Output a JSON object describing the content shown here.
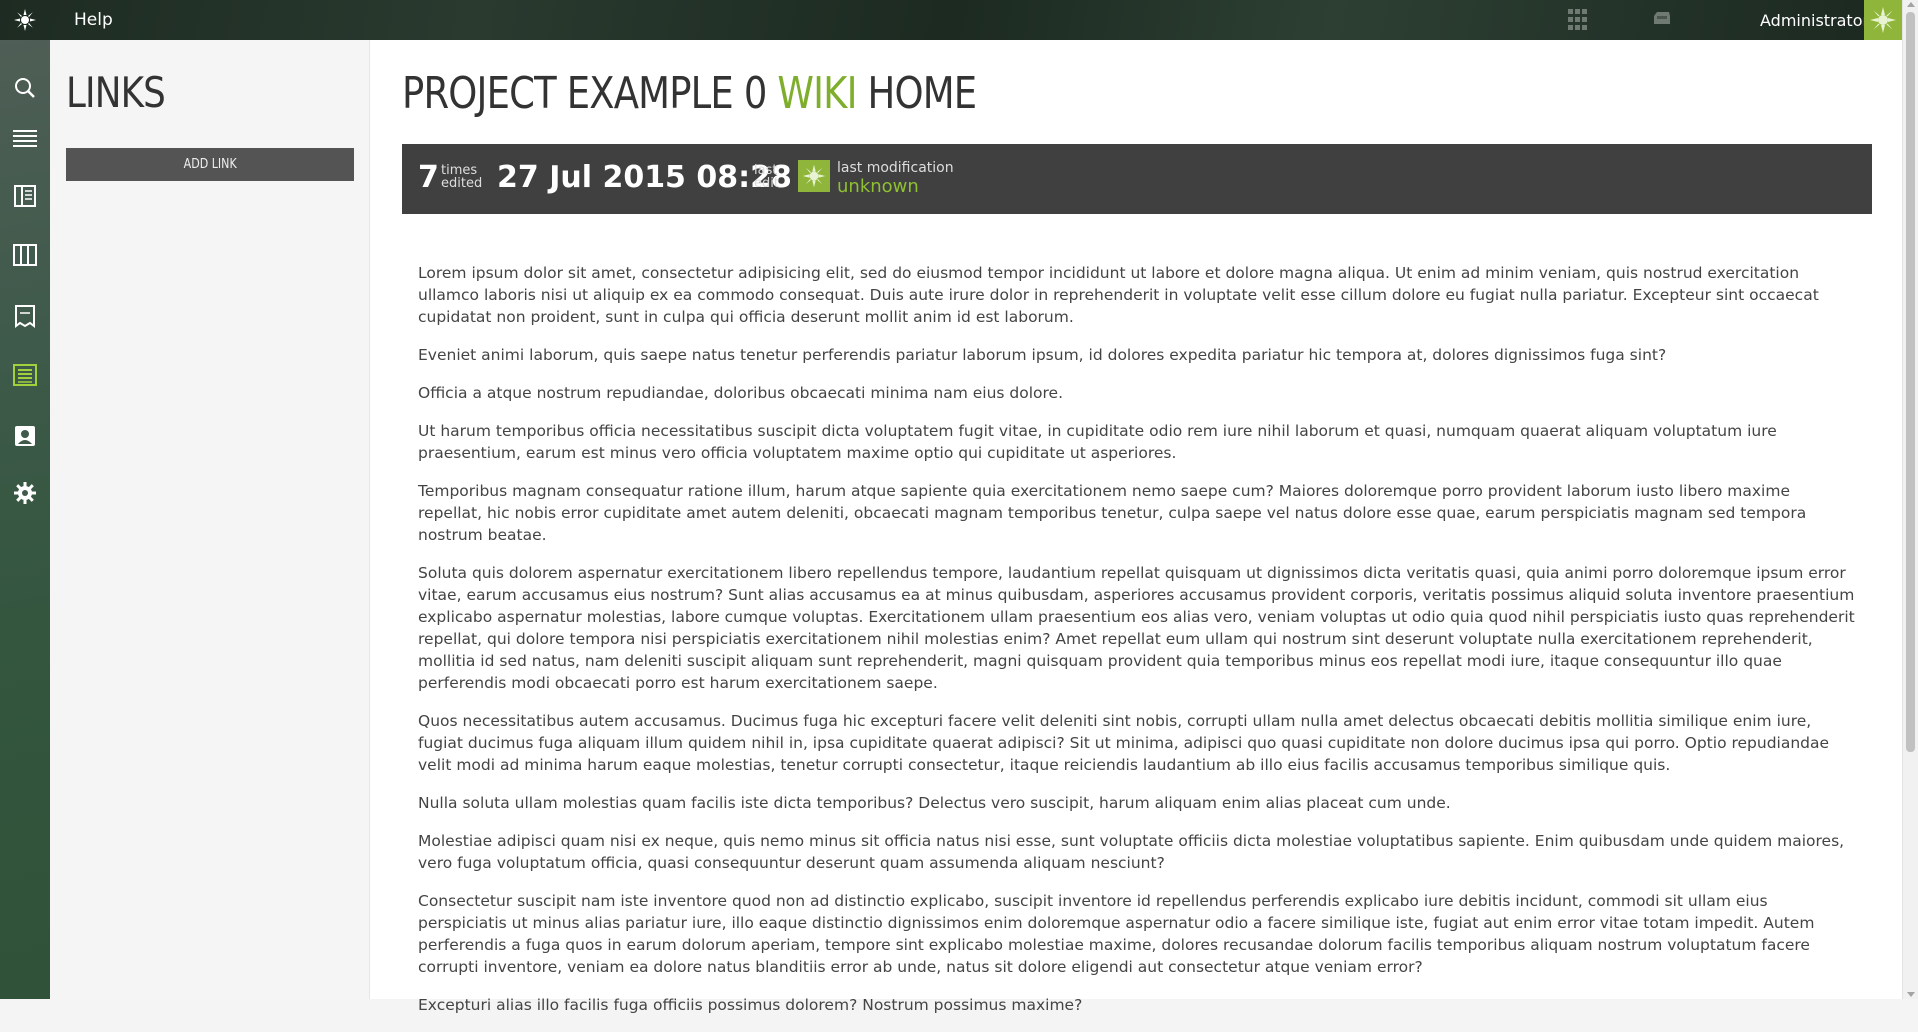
{
  "topbar": {
    "help_label": "Help",
    "user_name": "Administrator"
  },
  "links_panel": {
    "title": "LINKS",
    "add_link_label": "ADD LINK"
  },
  "page": {
    "title_part1": "PROJECT EXAMPLE 0 ",
    "title_accent": "WIKI",
    "title_part2": " HOME"
  },
  "stats": {
    "times_edited_value": "7",
    "times_edited_label_line1": "times",
    "times_edited_label_line2": "edited",
    "last_edit_value": "27 Jul 2015 08:28",
    "last_edit_label_line1": "last",
    "last_edit_label_line2": "edit",
    "last_modification_label": "last modification",
    "last_modification_user": "unknown"
  },
  "content": {
    "paragraphs": [
      "Lorem ipsum dolor sit amet, consectetur adipisicing elit, sed do eiusmod tempor incididunt ut labore et dolore magna aliqua. Ut enim ad minim veniam, quis nostrud exercitation ullamco laboris nisi ut aliquip ex ea commodo consequat. Duis aute irure dolor in reprehenderit in voluptate velit esse cillum dolore eu fugiat nulla pariatur. Excepteur sint occaecat cupidatat non proident, sunt in culpa qui officia deserunt mollit anim id est laborum.",
      "Eveniet animi laborum, quis saepe natus tenetur perferendis pariatur laborum ipsum, id dolores expedita pariatur hic tempora at, dolores dignissimos fuga sint?",
      "Officia a atque nostrum repudiandae, doloribus obcaecati minima nam eius dolore.",
      "Ut harum temporibus officia necessitatibus suscipit dicta voluptatem fugit vitae, in cupiditate odio rem iure nihil laborum et quasi, numquam quaerat aliquam voluptatum iure praesentium, earum est minus vero officia voluptatem maxime optio qui cupiditate ut asperiores.",
      "Temporibus magnam consequatur ratione illum, harum atque sapiente quia exercitationem nemo saepe cum? Maiores doloremque porro provident laborum iusto libero maxime repellat, hic nobis error cupiditate amet autem deleniti, obcaecati magnam temporibus tenetur, culpa saepe vel natus dolore esse quae, earum perspiciatis magnam sed tempora nostrum beatae.",
      "Soluta quis dolorem aspernatur exercitationem libero repellendus tempore, laudantium repellat quisquam ut dignissimos dicta veritatis quasi, quia animi porro doloremque ipsum error vitae, earum accusamus eius nostrum? Sunt alias accusamus ea at minus quibusdam, asperiores accusamus provident corporis, veritatis possimus aliquid soluta inventore praesentium explicabo aspernatur molestias, labore cumque voluptas. Exercitationem ullam praesentium eos alias vero, veniam voluptas ut odio quia quod nihil perspiciatis iusto quas reprehenderit repellat, qui dolore tempora nisi perspiciatis exercitationem nihil molestias enim? Amet repellat eum ullam qui nostrum sint deserunt voluptate nulla exercitationem reprehenderit, mollitia id sed natus, nam deleniti suscipit aliquam sunt reprehenderit, magni quisquam provident quia temporibus minus eos repellat modi iure, itaque consequuntur illo quae perferendis modi obcaecati porro est harum exercitationem saepe.",
      "Quos necessitatibus autem accusamus. Ducimus fuga hic excepturi facere velit deleniti sint nobis, corrupti ullam nulla amet delectus obcaecati debitis mollitia similique enim iure, fugiat ducimus fuga aliquam illum quidem nihil in, ipsa cupiditate quaerat adipisci? Sit ut minima, adipisci quo quasi cupiditate non dolore ducimus ipsa qui porro. Optio repudiandae velit modi ad minima harum eaque molestias, tenetur corrupti consectetur, itaque reiciendis laudantium ab illo eius facilis accusamus temporibus similique quis.",
      "Nulla soluta ullam molestias quam facilis iste dicta temporibus? Delectus vero suscipit, harum aliquam enim alias placeat cum unde.",
      "Molestiae adipisci quam nisi ex neque, quis nemo minus sit officia natus nisi esse, sunt voluptate officiis dicta molestiae voluptatibus sapiente. Enim quibusdam unde quidem maiores, vero fuga voluptatum officia, quasi consequuntur deserunt quam assumenda aliquam nesciunt?",
      "Consectetur suscipit nam iste inventore quod non ad distinctio explicabo, suscipit inventore id repellendus perferendis explicabo iure debitis incidunt, commodi sit ullam eius perspiciatis ut minus alias pariatur iure, illo eaque distinctio dignissimos enim doloremque aspernatur odio a facere similique iste, fugiat aut enim error vitae totam impedit. Autem perferendis a fuga quos in earum dolorum aperiam, tempore sint explicabo molestiae maxime, dolores recusandae dolorum facilis temporibus aliquam nostrum voluptatum facere corrupti inventore, veniam ea dolore natus blanditiis error ab unde, natus sit dolore eligendi aut consectetur atque veniam error?",
      "Excepturi alias illo facilis fuga officiis possimus dolorem? Nostrum possimus maxime?"
    ]
  },
  "colors": {
    "accent": "#7fae2c",
    "stats_bg": "#404040",
    "button_bg": "#545454"
  },
  "icons": {
    "topbar": [
      "logo-icon",
      "apps-grid-icon",
      "inbox-icon"
    ],
    "leftnav": [
      "search-icon",
      "list-icon",
      "book-icon",
      "columns-icon",
      "receipt-icon",
      "wiki-icon",
      "contact-card-icon",
      "gear-icon"
    ],
    "active_leftnav": "wiki-icon"
  }
}
